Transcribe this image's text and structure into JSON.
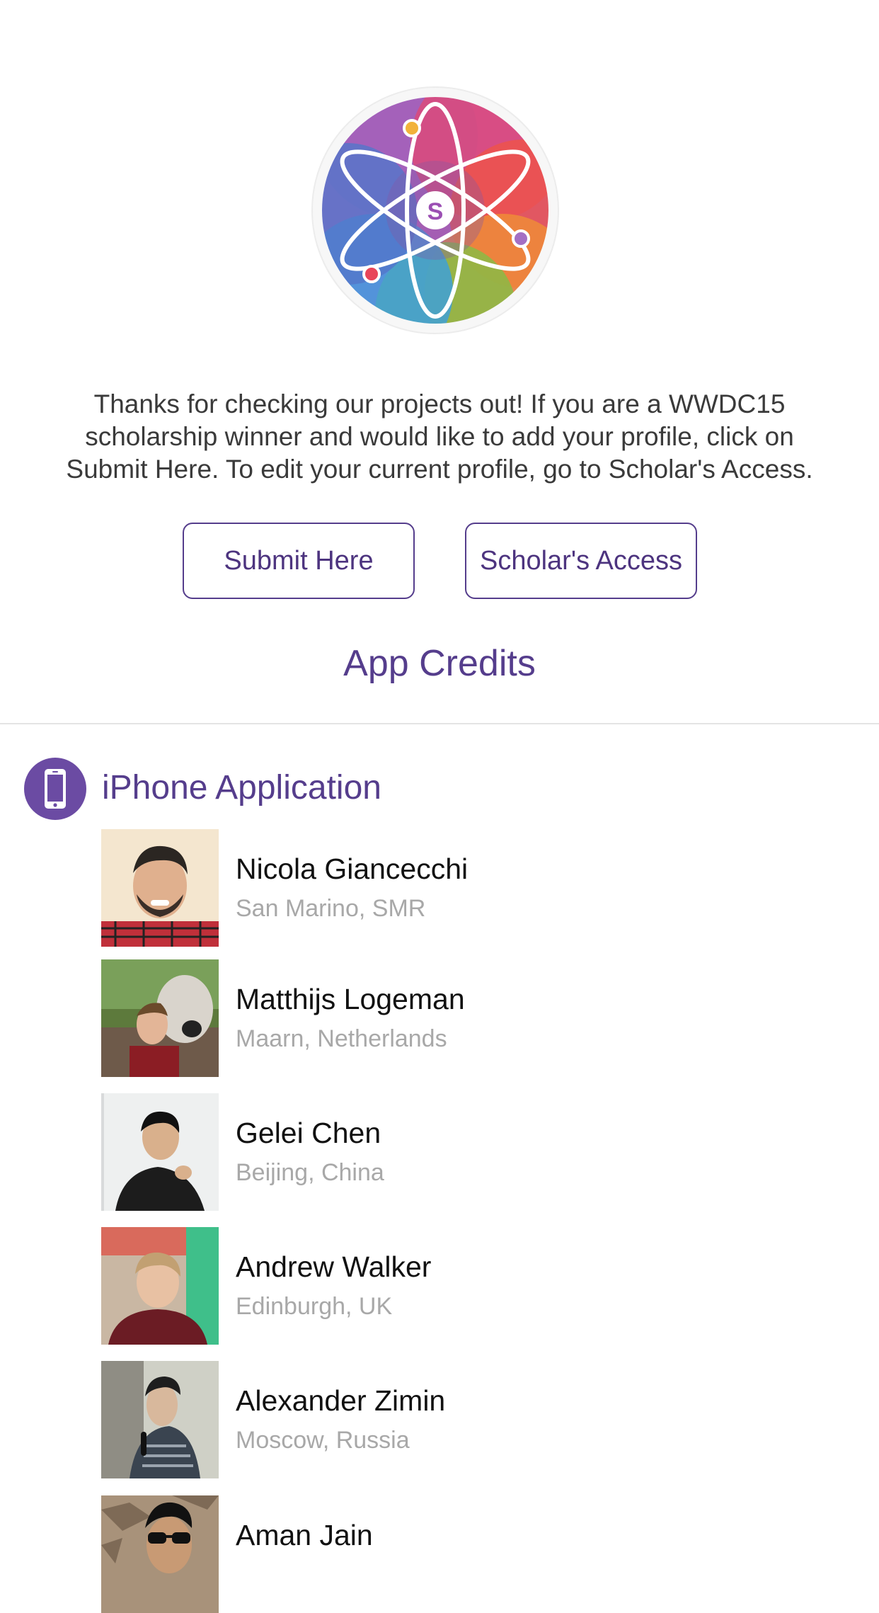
{
  "intro": {
    "line1": "Thanks for checking our projects out! If you are a WWDC15",
    "line2": "scholarship winner and would like to add your profile, click on",
    "line3": "Submit Here. To edit your current profile, go to Scholar's Access."
  },
  "logo": {
    "letter": "S",
    "icon": "atom-logo-icon"
  },
  "buttons": {
    "submit": "Submit Here",
    "access": "Scholar's Access"
  },
  "credits": {
    "title": "App Credits"
  },
  "section": {
    "title": "iPhone Application",
    "icon": "iphone-icon",
    "accent": "#6b4ba3"
  },
  "people": [
    {
      "name": "Nicola Giancecchi",
      "location": "San Marino, SMR"
    },
    {
      "name": "Matthijs Logeman",
      "location": "Maarn, Netherlands"
    },
    {
      "name": "Gelei Chen",
      "location": "Beijing, China"
    },
    {
      "name": "Andrew Walker",
      "location": "Edinburgh, UK"
    },
    {
      "name": "Alexander Zimin",
      "location": "Moscow, Russia"
    },
    {
      "name": "Aman Jain",
      "location": ""
    }
  ]
}
